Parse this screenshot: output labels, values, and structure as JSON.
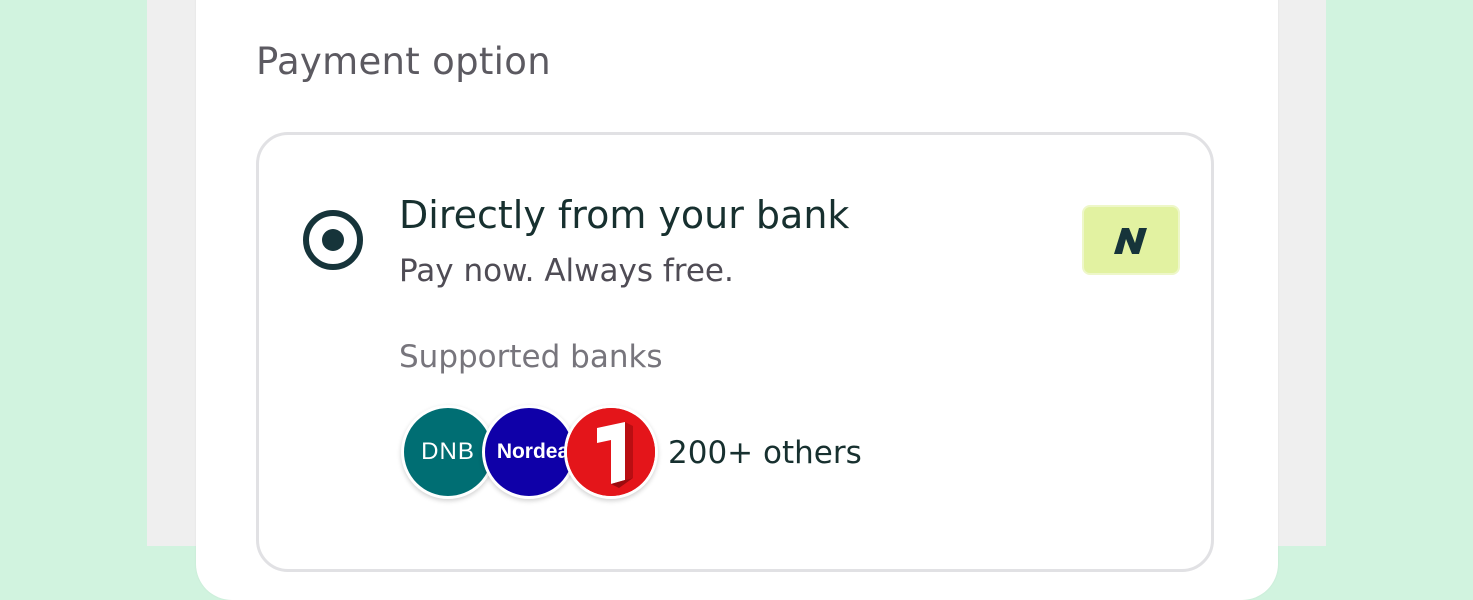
{
  "colors": {
    "page_background": "#d1f3df",
    "frame_background": "#efefef",
    "card_background": "#ffffff",
    "radio": "#16343a",
    "badge_background": "#e2f2a1",
    "dnb": "#006e73",
    "nordea": "#0f00a8",
    "sparebank1": "#e4151a"
  },
  "payment": {
    "section_title": "Payment option",
    "option": {
      "selected": true,
      "title": "Directly from your bank",
      "subtitle": "Pay now. Always free.",
      "badge_icon": "neonomics-n-logo-icon",
      "supported_banks_label": "Supported banks",
      "banks": [
        {
          "name": "DNB",
          "logo_text": "DNB"
        },
        {
          "name": "Nordea",
          "logo_text": "Nordea"
        },
        {
          "name": "SpareBank 1",
          "logo_text": "1"
        }
      ],
      "others_text": "200+ others"
    }
  }
}
